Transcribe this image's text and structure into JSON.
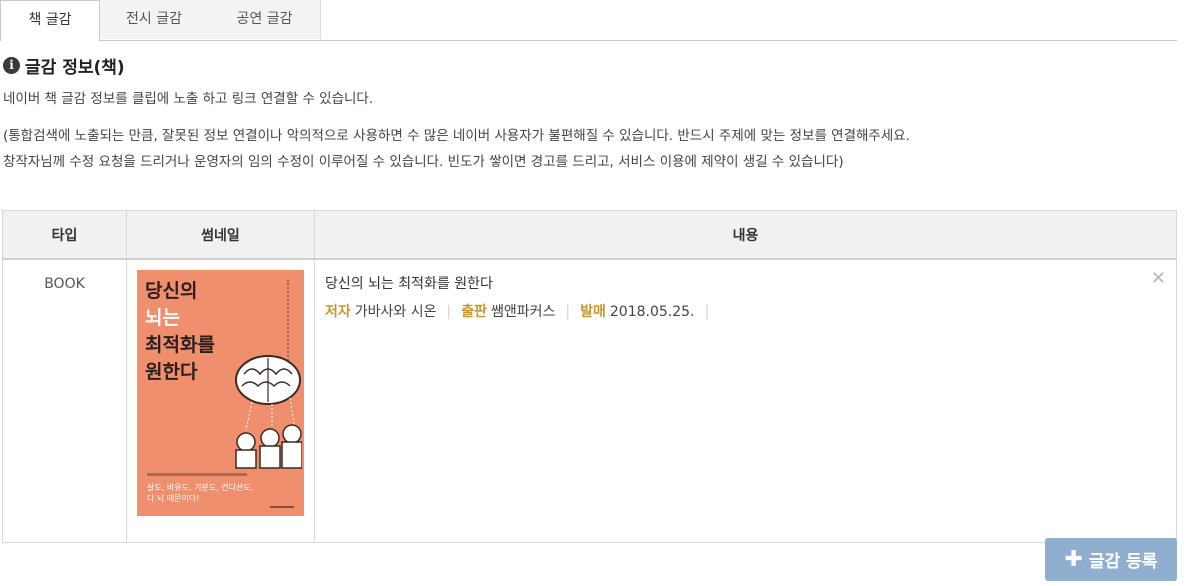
{
  "tabs": [
    {
      "label": "책 글감",
      "active": true
    },
    {
      "label": "전시 글감",
      "active": false
    },
    {
      "label": "공연 글감",
      "active": false
    }
  ],
  "section": {
    "icon": "info-icon",
    "icon_glyph": "i",
    "title": "글감 정보(책)",
    "description": "네이버 책 글감 정보를 클립에 노출 하고 링크 연결할 수 있습니다.",
    "notice_line1": "(통합검색에 노출되는 만큼, 잘못된 정보 연결이나 악의적으로 사용하면 수 많은 네이버 사용자가 불편해질 수 있습니다. 반드시 주제에 맞는 정보를 연결해주세요.",
    "notice_line2": "창작자님께 수정 요청을 드리거나 운영자의 임의 수정이 이루어질 수 있습니다. 빈도가 쌓이면 경고를 드리고, 서비스 이용에 제약이 생길 수 있습니다)"
  },
  "table": {
    "headers": [
      "타입",
      "썸네일",
      "내용"
    ],
    "row": {
      "type": "BOOK",
      "thumbnail": {
        "title_line1": "당신의",
        "title_line2": "뇌는",
        "title_line3": "최적화를",
        "title_line4": "원한다",
        "footer_line1": "살도, 비유도, 기분도, 건디션도,",
        "footer_line2": "다 뇌 때문이다!",
        "background": "#ef8f6d"
      },
      "title": "당신의 뇌는 최적화를 원한다",
      "author_label": "저자",
      "author": "가바사와 시온",
      "publisher_label": "출판",
      "publisher": "쌤앤파커스",
      "date_label": "발매",
      "date": "2018.05.25.",
      "separator": "|",
      "remove_glyph": "✕"
    }
  },
  "actions": {
    "add_label": "글감 등록",
    "add_icon": "plus-icon",
    "add_glyph": "✚",
    "accent": "#8faed0"
  },
  "colors": {
    "meta_label": "#c9962e"
  }
}
